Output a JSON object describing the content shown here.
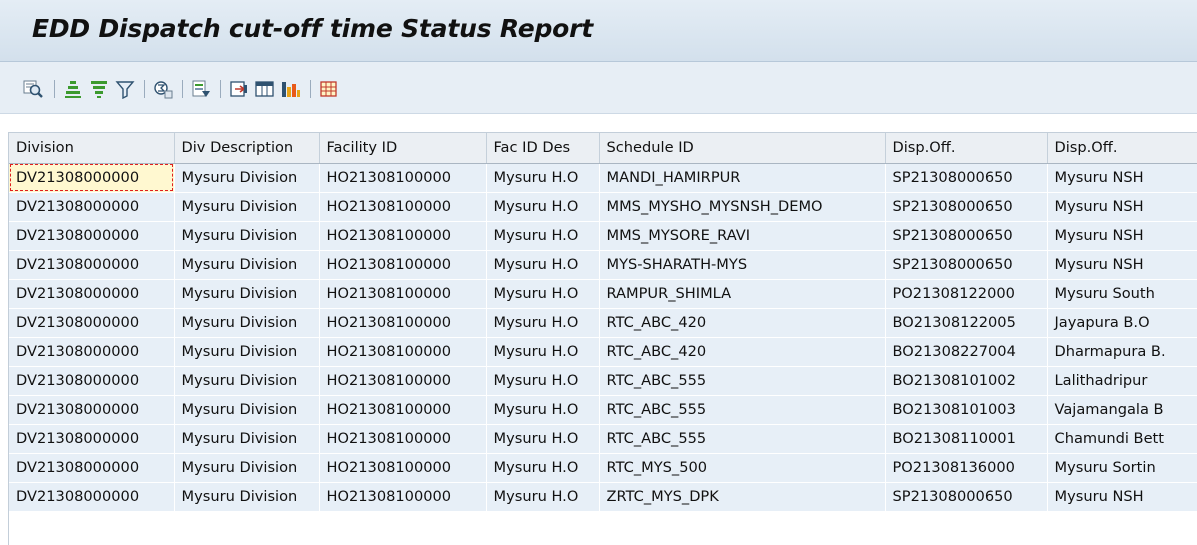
{
  "report": {
    "title": "EDD Dispatch cut-off time Status Report"
  },
  "toolbar": {
    "buttons": [
      {
        "name": "details-button",
        "icon": "magnifier-details-icon"
      },
      {
        "name": "sort-ascending-button",
        "icon": "sort-ascending-icon"
      },
      {
        "name": "sort-descending-button",
        "icon": "sort-descending-icon"
      },
      {
        "name": "filter-button",
        "icon": "filter-funnel-icon"
      },
      {
        "name": "total-button",
        "icon": "sum-icon"
      },
      {
        "name": "print-preview-button",
        "icon": "print-preview-icon"
      },
      {
        "name": "export-button",
        "icon": "export-icon"
      },
      {
        "name": "change-layout-button",
        "icon": "layout-icon"
      },
      {
        "name": "graphic-button",
        "icon": "bar-chart-icon"
      },
      {
        "name": "select-layout-button",
        "icon": "table-grid-icon"
      }
    ]
  },
  "grid": {
    "columns": [
      "Division",
      "Div Description",
      "Facility ID",
      "Fac ID Des",
      "Schedule ID",
      "Disp.Off.",
      "Disp.Off."
    ],
    "rows": [
      [
        "DV21308000000",
        "Mysuru Division",
        "HO21308100000",
        "Mysuru H.O",
        "MANDI_HAMIRPUR",
        "SP21308000650",
        "Mysuru NSH"
      ],
      [
        "DV21308000000",
        "Mysuru Division",
        "HO21308100000",
        "Mysuru H.O",
        "MMS_MYSHO_MYSNSH_DEMO",
        "SP21308000650",
        "Mysuru NSH"
      ],
      [
        "DV21308000000",
        "Mysuru Division",
        "HO21308100000",
        "Mysuru H.O",
        "MMS_MYSORE_RAVI",
        "SP21308000650",
        "Mysuru NSH"
      ],
      [
        "DV21308000000",
        "Mysuru Division",
        "HO21308100000",
        "Mysuru H.O",
        "MYS-SHARATH-MYS",
        "SP21308000650",
        "Mysuru NSH"
      ],
      [
        "DV21308000000",
        "Mysuru Division",
        "HO21308100000",
        "Mysuru H.O",
        "RAMPUR_SHIMLA",
        "PO21308122000",
        "Mysuru South"
      ],
      [
        "DV21308000000",
        "Mysuru Division",
        "HO21308100000",
        "Mysuru H.O",
        "RTC_ABC_420",
        "BO21308122005",
        "Jayapura B.O"
      ],
      [
        "DV21308000000",
        "Mysuru Division",
        "HO21308100000",
        "Mysuru H.O",
        "RTC_ABC_420",
        "BO21308227004",
        "Dharmapura B."
      ],
      [
        "DV21308000000",
        "Mysuru Division",
        "HO21308100000",
        "Mysuru H.O",
        "RTC_ABC_555",
        "BO21308101002",
        "Lalithadripur"
      ],
      [
        "DV21308000000",
        "Mysuru Division",
        "HO21308100000",
        "Mysuru H.O",
        "RTC_ABC_555",
        "BO21308101003",
        "Vajamangala B"
      ],
      [
        "DV21308000000",
        "Mysuru Division",
        "HO21308100000",
        "Mysuru H.O",
        "RTC_ABC_555",
        "BO21308110001",
        "Chamundi Bett"
      ],
      [
        "DV21308000000",
        "Mysuru Division",
        "HO21308100000",
        "Mysuru H.O",
        "RTC_MYS_500",
        "PO21308136000",
        "Mysuru Sortin"
      ],
      [
        "DV21308000000",
        "Mysuru Division",
        "HO21308100000",
        "Mysuru H.O",
        "ZRTC_MYS_DPK",
        "SP21308000650",
        "Mysuru NSH"
      ]
    ]
  }
}
